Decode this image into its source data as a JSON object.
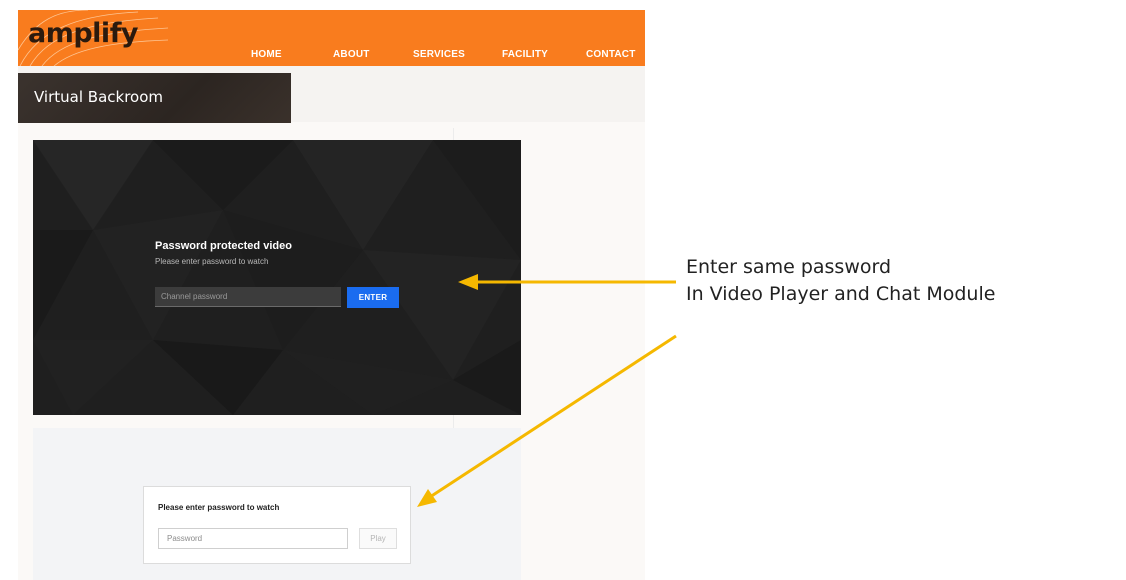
{
  "header": {
    "logo": "amplify",
    "nav": [
      "HOME",
      "ABOUT",
      "SERVICES",
      "FACILITY",
      "CONTACT"
    ],
    "brand_color": "#f97c1e"
  },
  "page": {
    "title": "Virtual Backroom"
  },
  "player": {
    "title": "Password protected video",
    "subtitle": "Please enter password to watch",
    "input_placeholder": "Channel password",
    "enter_label": "ENTER",
    "button_color": "#1a6cf0"
  },
  "chat": {
    "prompt": "Please enter password to watch",
    "input_placeholder": "Password",
    "play_label": "Play"
  },
  "annotation": {
    "line1": "Enter same password",
    "line2": "In Video Player and Chat Module",
    "arrow_color": "#f5b800"
  }
}
